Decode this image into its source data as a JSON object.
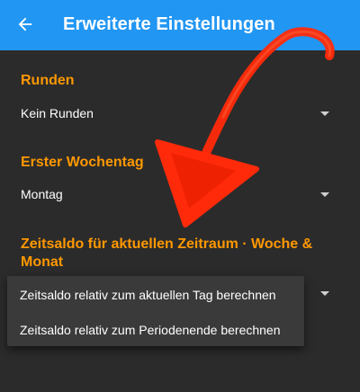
{
  "appbar": {
    "title": "Erweiterte Einstellungen",
    "back_icon": "arrow-left-icon",
    "color": "#2196f3"
  },
  "accent_color": "#ff9800",
  "sections": [
    {
      "title": "Runden",
      "value": "Kein Runden"
    },
    {
      "title": "Erster Wochentag",
      "value": "Montag"
    },
    {
      "title_line1": "Zeitsaldo für aktuellen Zeitraum · Woche &",
      "title_line2": "Monat"
    }
  ],
  "dropdown": {
    "options": [
      "Zeitsaldo relativ zum aktuellen Tag berechnen",
      "Zeitsaldo relativ zum Periodenende berechnen"
    ]
  },
  "annotation": {
    "color": "#ff2a0a",
    "icon": "curved-arrow-icon"
  }
}
